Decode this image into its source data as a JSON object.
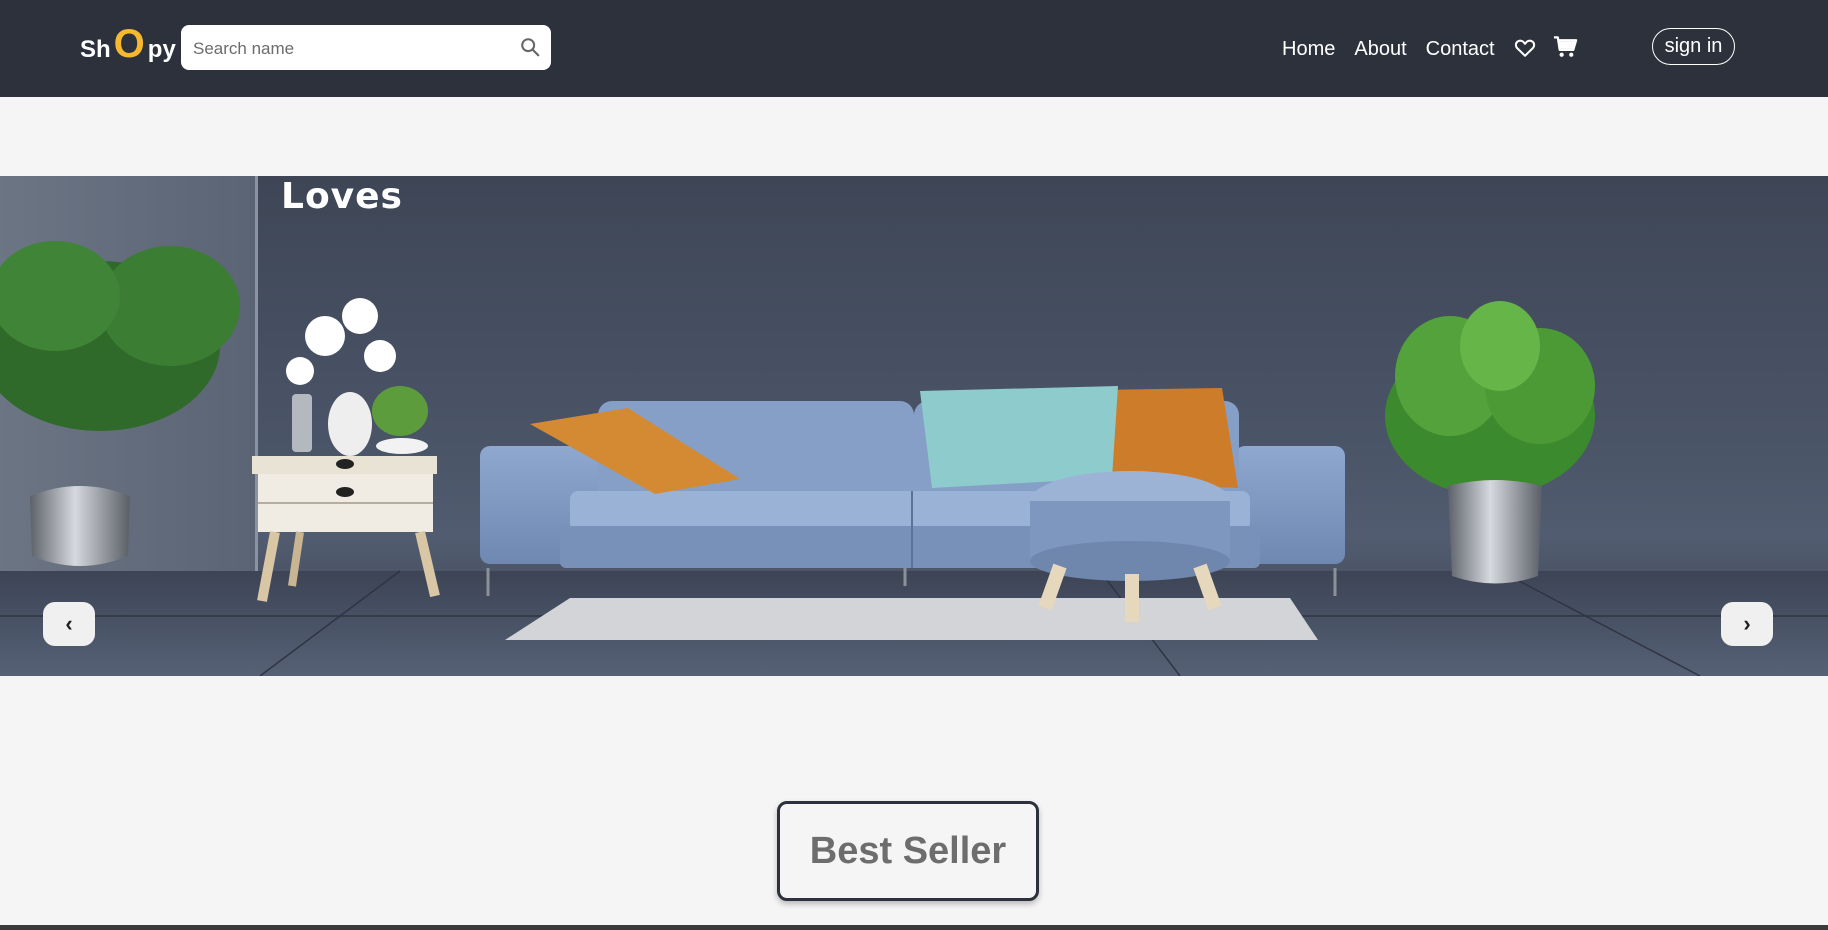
{
  "navbar": {
    "logo": {
      "prefix": "Sh",
      "highlight": "O",
      "suffix": "py"
    },
    "search": {
      "placeholder": "Search name",
      "value": ""
    },
    "links": [
      "Home",
      "About",
      "Contact"
    ],
    "icons": [
      "heart-icon",
      "cart-icon",
      "search-icon"
    ],
    "signin_label": "sign in"
  },
  "hero": {
    "caption": "Loves",
    "prev_label": "‹",
    "next_label": "›"
  },
  "section": {
    "title": "Best Seller"
  },
  "colors": {
    "navbar_bg": "#2c313c",
    "accent": "#f5b82e",
    "page_bg": "#f5f5f5"
  }
}
